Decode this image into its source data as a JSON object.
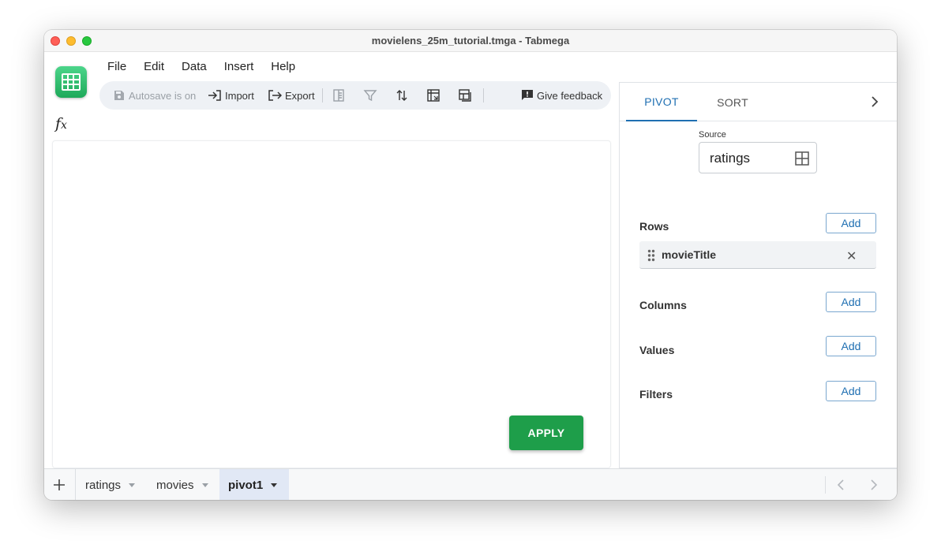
{
  "window": {
    "title": "movielens_25m_tutorial.tmga - Tabmega"
  },
  "menu": [
    "File",
    "Edit",
    "Data",
    "Insert",
    "Help"
  ],
  "toolbar": {
    "autosave_label": "Autosave is on",
    "import_label": "Import",
    "export_label": "Export",
    "feedback_label": "Give feedback"
  },
  "formula_bar": {
    "icon": "fx-icon"
  },
  "canvas": {
    "apply_label": "APPLY",
    "apply_color": "#1e9e4a"
  },
  "panel": {
    "tabs": [
      "PIVOT",
      "SORT"
    ],
    "active_tab": "PIVOT",
    "accent_color": "#1f6fb2",
    "source_label": "Source",
    "source_value": "ratings",
    "sections": {
      "rows": "Rows",
      "columns": "Columns",
      "values": "Values",
      "filters": "Filters"
    },
    "add_label": "Add",
    "rows_items": [
      "movieTitle"
    ]
  },
  "sheets": {
    "tabs": [
      "ratings",
      "movies",
      "pivot1"
    ],
    "active": "pivot1"
  }
}
